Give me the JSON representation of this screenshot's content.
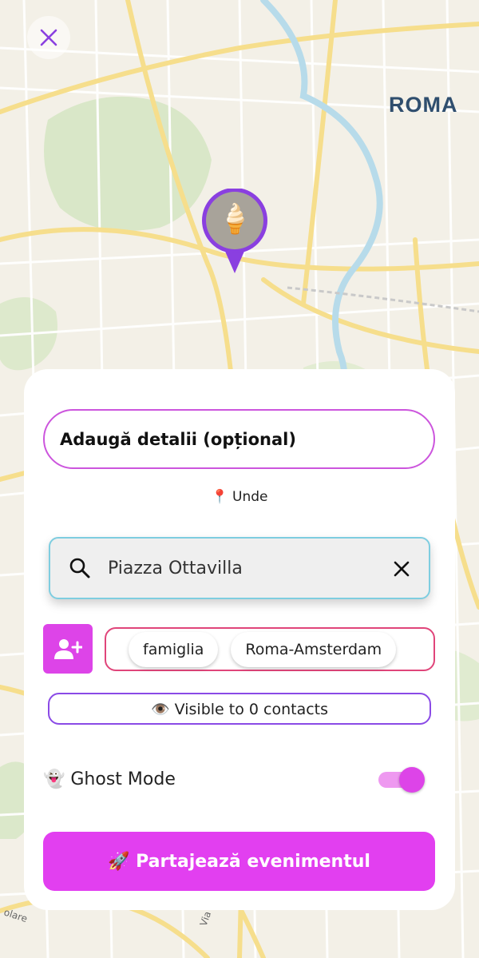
{
  "map": {
    "city_label": "ROMA",
    "pin_emoji": "🍦",
    "street_labels": [
      "Via",
      "olare"
    ]
  },
  "form": {
    "details_placeholder": "Adaugă detalii (opțional)",
    "where_label": "📍 Unde",
    "search_value": "Piazza Ottavilla",
    "groups": [
      "famiglia",
      "Roma-Amsterdam"
    ],
    "visible_text": "👁️ Visible to 0 contacts",
    "ghost_mode_label": "👻 Ghost Mode",
    "ghost_mode_on": true,
    "share_button": "🚀 Partajează evenimentul"
  },
  "icons": {
    "close": "close-icon",
    "search": "search-icon",
    "clear": "clear-icon",
    "add_contact": "person-add-icon"
  },
  "colors": {
    "accent": "#dd44e8",
    "pin_ring": "#8a3fe0",
    "search_border": "#7ecde0",
    "groups_border": "#e0457a",
    "visible_border": "#8a4ae6"
  }
}
